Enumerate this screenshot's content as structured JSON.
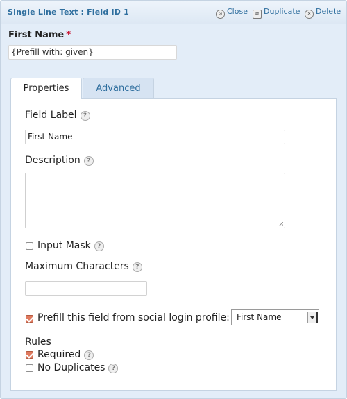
{
  "header": {
    "title": "Single Line Text : Field ID 1",
    "actions": [
      {
        "label": "Close",
        "icon": "close-circle-icon"
      },
      {
        "label": "Duplicate",
        "icon": "duplicate-icon"
      },
      {
        "label": "Delete",
        "icon": "delete-x-icon"
      }
    ]
  },
  "field_preview": {
    "label": "First Name",
    "required_marker": "*",
    "value": "{Prefill with: given}"
  },
  "tabs": [
    {
      "label": "Properties",
      "active": true
    },
    {
      "label": "Advanced",
      "active": false
    }
  ],
  "properties": {
    "field_label": {
      "label": "Field Label",
      "value": "First Name"
    },
    "description": {
      "label": "Description",
      "value": ""
    },
    "input_mask": {
      "label": "Input Mask",
      "checked": false
    },
    "maximum_characters": {
      "label": "Maximum Characters",
      "value": ""
    },
    "prefill_social": {
      "label": "Prefill this field from social login profile:",
      "checked": true,
      "selected": "First Name"
    },
    "rules": {
      "heading": "Rules",
      "required": {
        "label": "Required",
        "checked": true
      },
      "no_duplicates": {
        "label": "No Duplicates",
        "checked": false
      }
    }
  },
  "help_glyph": "?",
  "colors": {
    "accent": "#2e6e9e",
    "panel_bg": "#e3edf8",
    "checkbox_checked": "#e07a5f",
    "required_star": "#c8102e"
  }
}
